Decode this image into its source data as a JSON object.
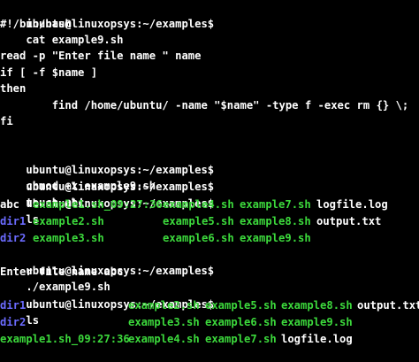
{
  "terminal": {
    "colors": {
      "background": "#000000",
      "text": "#ffffff",
      "executable_green": "#3cd93c",
      "directory_blue": "#6b6bff",
      "cursor": "#2fd12f"
    },
    "prompt": "ubuntu@linuxopsys:~/examples$",
    "commands": {
      "cat": "cat example9.sh",
      "chmod": "chmod +x example9.sh",
      "touch": "touch abc",
      "ls1": "ls",
      "run": "./example9.sh",
      "ls2": "ls"
    },
    "script": {
      "shebang": "#!/bin/bash",
      "read": "read -p \"Enter file name \" name",
      "if": "if [ -f $name ]",
      "then": "then",
      "find": "        find /home/ubuntu/ -name \"$name\" -type f -exec rm {} \\;",
      "fi": "fi"
    },
    "ls1": {
      "row1": [
        "abc",
        "example1.sh_09:27:36",
        "example4.sh",
        "example7.sh",
        "logfile.log"
      ],
      "row2": [
        "dir1",
        "example2.sh",
        "example5.sh",
        "example8.sh",
        "output.txt"
      ],
      "row3": [
        "dir2",
        "example3.sh",
        "example6.sh",
        "example9.sh"
      ]
    },
    "run_output": "Enter file name abc",
    "ls2": {
      "row1": [
        "dir1",
        "example2.sh",
        "example5.sh",
        "example8.sh",
        "output.txt"
      ],
      "row2": [
        "dir2",
        "example3.sh",
        "example6.sh",
        "example9.sh"
      ],
      "row3": [
        "example1.sh_09:27:36",
        "example4.sh",
        "example7.sh",
        "logfile.log"
      ]
    }
  }
}
